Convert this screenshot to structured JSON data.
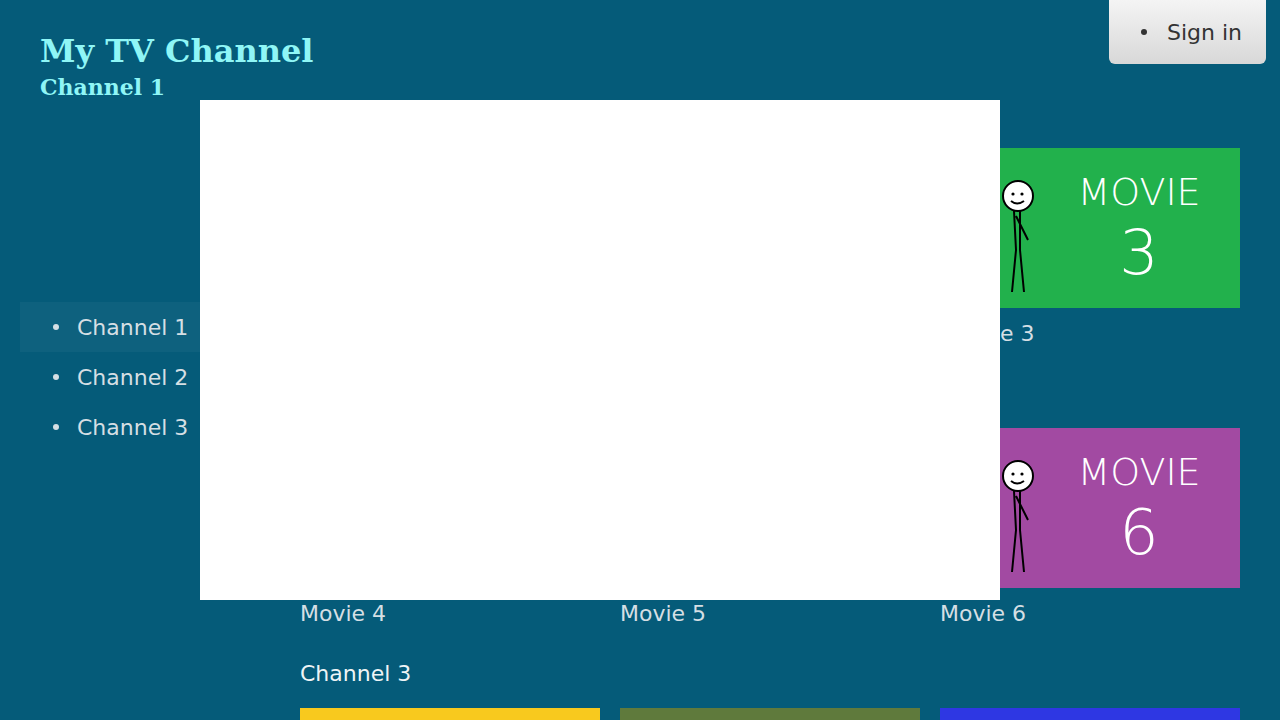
{
  "header": {
    "title": "My TV Channel",
    "subtitle": "Channel 1"
  },
  "sign_in": {
    "label": "Sign in"
  },
  "nav": {
    "items": [
      {
        "label": "Channel 1",
        "selected": true
      },
      {
        "label": "Channel 2",
        "selected": false
      },
      {
        "label": "Channel 3",
        "selected": false
      }
    ]
  },
  "rows": [
    {
      "items": [
        {
          "caption": "e 3",
          "caption_cut": true,
          "color": "#22b14c",
          "poster": {
            "title": "MOVIE",
            "number": "3"
          }
        }
      ]
    },
    {
      "items": [
        {
          "caption": "Movie 4",
          "caption_cut": false
        },
        {
          "caption": "Movie 5",
          "caption_cut": false
        },
        {
          "caption": "Movie 6",
          "caption_cut": false,
          "color": "#a24aa2",
          "poster": {
            "title": "MOVIE",
            "number": "6"
          }
        }
      ]
    },
    {
      "title": "Channel 3",
      "items": [
        {
          "color": "#f8c91e"
        },
        {
          "color": "#5f7a3c"
        },
        {
          "color": "#2e37e3"
        }
      ]
    }
  ]
}
